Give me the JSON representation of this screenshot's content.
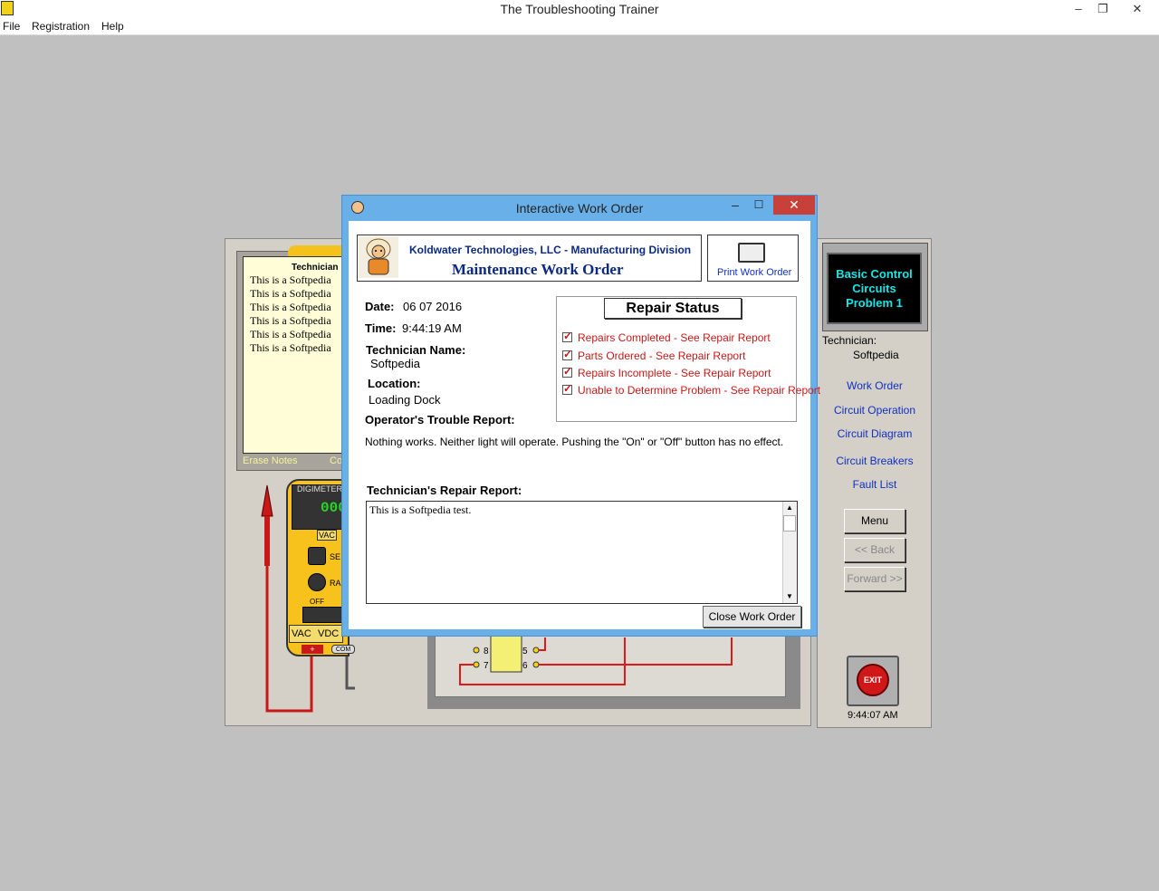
{
  "app": {
    "title": "The Troubleshooting Trainer",
    "window_controls": [
      "–",
      "❐",
      "✕"
    ]
  },
  "menu": {
    "items": [
      "File",
      "Registration",
      "Help"
    ]
  },
  "notes": {
    "tab_label": "Technician",
    "lines": [
      "This is a Softpedia",
      "This is a Softpedia",
      "This is a Softpedia",
      "This is a Softpedia",
      "This is a Softpedia",
      "This is a Softpedia"
    ],
    "erase_label": "Erase Notes",
    "co_label": "Co"
  },
  "meter": {
    "brand": "DIGIMETER",
    "reading": "000",
    "vac_tag": "VAC",
    "sel_tag": "SE",
    "ra_tag": "RA",
    "off_label": "OFF",
    "mode_labels": [
      "VAC",
      "VDC"
    ],
    "plus_label": "+",
    "com_label": "COM"
  },
  "right_panel": {
    "problem": "Basic Control Circuits Problem 1",
    "technician_label": "Technician:",
    "technician_name": "Softpedia",
    "links": [
      "Work Order",
      "Circuit Operation",
      "Circuit Diagram",
      "Circuit Breakers",
      "Fault List"
    ],
    "buttons": {
      "menu": "Menu",
      "back": "<< Back",
      "forward": "Forward >>"
    },
    "exit_label": "EXIT",
    "clock": "9:44:07 AM"
  },
  "dialog": {
    "title": "Interactive Work Order",
    "controls": {
      "minimize": "–",
      "maximize": "☐",
      "close": "✕"
    },
    "company": "Koldwater Technologies, LLC - Manufacturing Division",
    "work_order_title": "Maintenance Work Order",
    "print_label": "Print Work Order",
    "date_label": "Date:",
    "date_value": "06 07 2016",
    "time_label": "Time:",
    "time_value": "9:44:19 AM",
    "technician_label": "Technician Name:",
    "technician_value": "Softpedia",
    "location_label": "Location:",
    "location_value": "Loading Dock",
    "trouble_label": "Operator's Trouble Report:",
    "trouble_text": "Nothing works.  Neither light will operate.  Pushing the \"On\" or \"Off\" button has no effect.",
    "repair_status_title": "Repair Status",
    "status_items": [
      "Repairs Completed - See Repair Report",
      "Parts Ordered - See Repair Report",
      "Repairs Incomplete - See Repair Report",
      "Unable to Determine Problem - See Repair Report"
    ],
    "repair_label": "Technician's Repair Report:",
    "repair_text": "This is a Softpedia test.",
    "close_label": "Close Work Order",
    "scroll": {
      "up": "▲",
      "down": "▼"
    }
  },
  "colors": {
    "accent_blue": "#1030c0",
    "status_red": "#c81818",
    "title_blue": "#6ab0e8",
    "problem_cyan": "#18e6e6"
  }
}
